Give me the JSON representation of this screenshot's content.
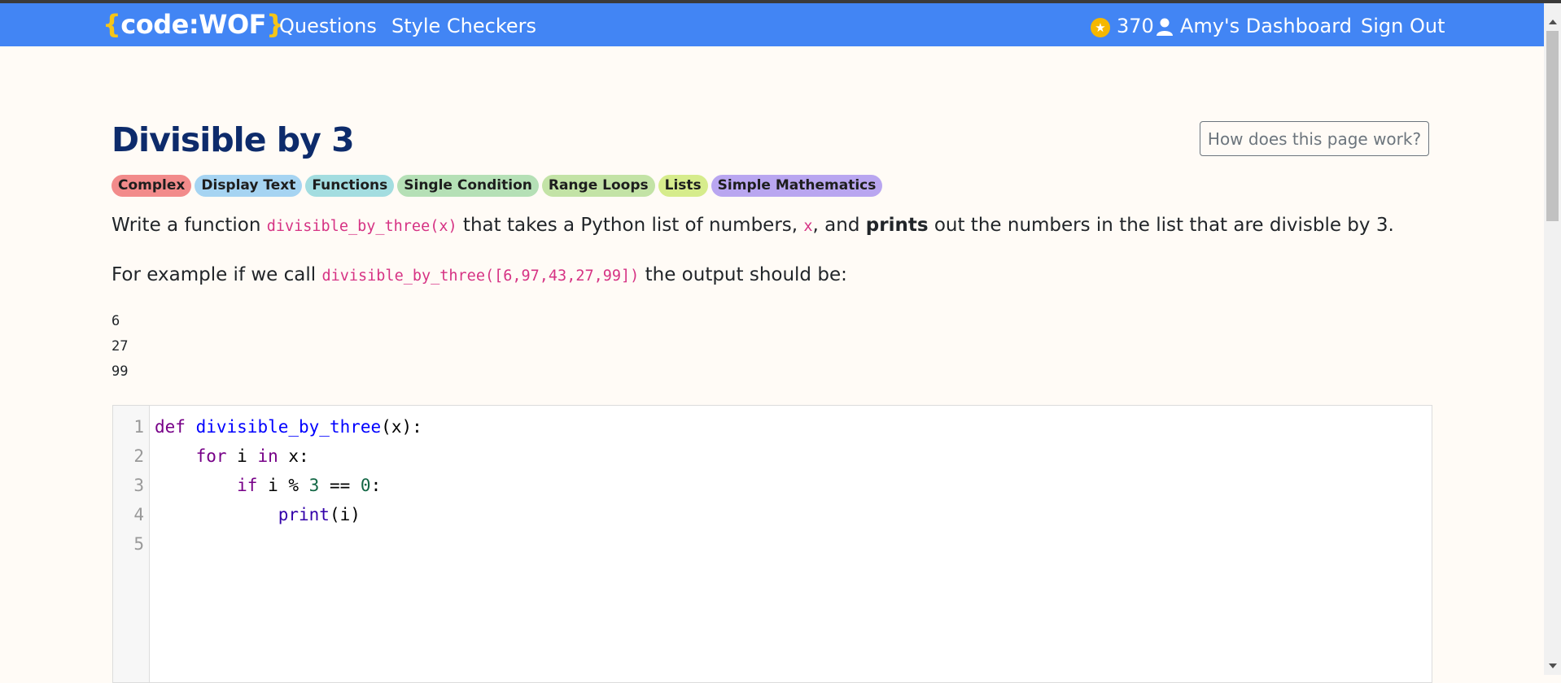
{
  "navbar": {
    "brand_left_brace": "{",
    "brand_name": "code:WOF",
    "brand_right_brace": "}",
    "links": [
      "Questions",
      "Style Checkers"
    ],
    "points": "370",
    "dashboard": "Amy's Dashboard",
    "sign_out": "Sign Out",
    "colors": {
      "background": "#4285f4",
      "brace": "#f5c518"
    },
    "icons": [
      "star-icon",
      "user-icon"
    ]
  },
  "question": {
    "title": "Divisible by 3",
    "help_button": "How does this page work?",
    "tags": [
      {
        "label": "Complex",
        "color": "#f28b8b"
      },
      {
        "label": "Display Text",
        "color": "#a6d4f2"
      },
      {
        "label": "Functions",
        "color": "#a3dde0"
      },
      {
        "label": "Single Condition",
        "color": "#b5e0b6"
      },
      {
        "label": "Range Loops",
        "color": "#c3e3a6"
      },
      {
        "label": "Lists",
        "color": "#d6ec8c"
      },
      {
        "label": "Simple Mathematics",
        "color": "#b9a6f0"
      }
    ],
    "desc1": {
      "t1": "Write a function ",
      "c1": "divisible_by_three(x)",
      "t2": " that takes a Python list of numbers, ",
      "c2": "x",
      "t3": ", and ",
      "b1": "prints",
      "t4": " out the numbers in the list that are divisble by 3."
    },
    "desc2": {
      "t1": "For example if we call ",
      "c1": "divisible_by_three([6,97,43,27,99])",
      "t2": " the output should be:"
    },
    "output": [
      "6",
      "27",
      "99"
    ]
  },
  "editor": {
    "line_numbers": [
      "1",
      "2",
      "3",
      "4",
      "5"
    ],
    "lines": [
      [
        {
          "t": "def",
          "c": "kw"
        },
        {
          "t": " "
        },
        {
          "t": "divisible_by_three",
          "c": "def"
        },
        {
          "t": "(x):"
        }
      ],
      [
        {
          "t": "    "
        },
        {
          "t": "for",
          "c": "kw"
        },
        {
          "t": " i "
        },
        {
          "t": "in",
          "c": "kw"
        },
        {
          "t": " x:"
        }
      ],
      [
        {
          "t": "        "
        },
        {
          "t": "if",
          "c": "kw"
        },
        {
          "t": " i % "
        },
        {
          "t": "3",
          "c": "num"
        },
        {
          "t": " == "
        },
        {
          "t": "0",
          "c": "num"
        },
        {
          "t": ":"
        }
      ],
      [
        {
          "t": "            "
        },
        {
          "t": "print",
          "c": "bi"
        },
        {
          "t": "(i)"
        }
      ],
      []
    ]
  }
}
